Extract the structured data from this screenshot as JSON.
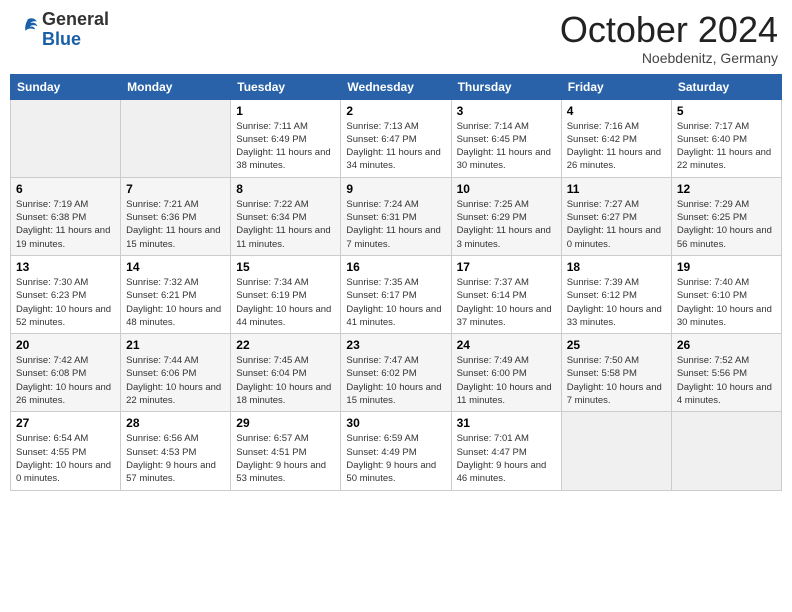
{
  "header": {
    "logo_general": "General",
    "logo_blue": "Blue",
    "month_title": "October 2024",
    "location": "Noebdenitz, Germany"
  },
  "weekdays": [
    "Sunday",
    "Monday",
    "Tuesday",
    "Wednesday",
    "Thursday",
    "Friday",
    "Saturday"
  ],
  "weeks": [
    [
      {
        "day": "",
        "empty": true
      },
      {
        "day": "",
        "empty": true
      },
      {
        "day": "1",
        "line1": "Sunrise: 7:11 AM",
        "line2": "Sunset: 6:49 PM",
        "line3": "Daylight: 11 hours and 38 minutes."
      },
      {
        "day": "2",
        "line1": "Sunrise: 7:13 AM",
        "line2": "Sunset: 6:47 PM",
        "line3": "Daylight: 11 hours and 34 minutes."
      },
      {
        "day": "3",
        "line1": "Sunrise: 7:14 AM",
        "line2": "Sunset: 6:45 PM",
        "line3": "Daylight: 11 hours and 30 minutes."
      },
      {
        "day": "4",
        "line1": "Sunrise: 7:16 AM",
        "line2": "Sunset: 6:42 PM",
        "line3": "Daylight: 11 hours and 26 minutes."
      },
      {
        "day": "5",
        "line1": "Sunrise: 7:17 AM",
        "line2": "Sunset: 6:40 PM",
        "line3": "Daylight: 11 hours and 22 minutes."
      }
    ],
    [
      {
        "day": "6",
        "line1": "Sunrise: 7:19 AM",
        "line2": "Sunset: 6:38 PM",
        "line3": "Daylight: 11 hours and 19 minutes."
      },
      {
        "day": "7",
        "line1": "Sunrise: 7:21 AM",
        "line2": "Sunset: 6:36 PM",
        "line3": "Daylight: 11 hours and 15 minutes."
      },
      {
        "day": "8",
        "line1": "Sunrise: 7:22 AM",
        "line2": "Sunset: 6:34 PM",
        "line3": "Daylight: 11 hours and 11 minutes."
      },
      {
        "day": "9",
        "line1": "Sunrise: 7:24 AM",
        "line2": "Sunset: 6:31 PM",
        "line3": "Daylight: 11 hours and 7 minutes."
      },
      {
        "day": "10",
        "line1": "Sunrise: 7:25 AM",
        "line2": "Sunset: 6:29 PM",
        "line3": "Daylight: 11 hours and 3 minutes."
      },
      {
        "day": "11",
        "line1": "Sunrise: 7:27 AM",
        "line2": "Sunset: 6:27 PM",
        "line3": "Daylight: 11 hours and 0 minutes."
      },
      {
        "day": "12",
        "line1": "Sunrise: 7:29 AM",
        "line2": "Sunset: 6:25 PM",
        "line3": "Daylight: 10 hours and 56 minutes."
      }
    ],
    [
      {
        "day": "13",
        "line1": "Sunrise: 7:30 AM",
        "line2": "Sunset: 6:23 PM",
        "line3": "Daylight: 10 hours and 52 minutes."
      },
      {
        "day": "14",
        "line1": "Sunrise: 7:32 AM",
        "line2": "Sunset: 6:21 PM",
        "line3": "Daylight: 10 hours and 48 minutes."
      },
      {
        "day": "15",
        "line1": "Sunrise: 7:34 AM",
        "line2": "Sunset: 6:19 PM",
        "line3": "Daylight: 10 hours and 44 minutes."
      },
      {
        "day": "16",
        "line1": "Sunrise: 7:35 AM",
        "line2": "Sunset: 6:17 PM",
        "line3": "Daylight: 10 hours and 41 minutes."
      },
      {
        "day": "17",
        "line1": "Sunrise: 7:37 AM",
        "line2": "Sunset: 6:14 PM",
        "line3": "Daylight: 10 hours and 37 minutes."
      },
      {
        "day": "18",
        "line1": "Sunrise: 7:39 AM",
        "line2": "Sunset: 6:12 PM",
        "line3": "Daylight: 10 hours and 33 minutes."
      },
      {
        "day": "19",
        "line1": "Sunrise: 7:40 AM",
        "line2": "Sunset: 6:10 PM",
        "line3": "Daylight: 10 hours and 30 minutes."
      }
    ],
    [
      {
        "day": "20",
        "line1": "Sunrise: 7:42 AM",
        "line2": "Sunset: 6:08 PM",
        "line3": "Daylight: 10 hours and 26 minutes."
      },
      {
        "day": "21",
        "line1": "Sunrise: 7:44 AM",
        "line2": "Sunset: 6:06 PM",
        "line3": "Daylight: 10 hours and 22 minutes."
      },
      {
        "day": "22",
        "line1": "Sunrise: 7:45 AM",
        "line2": "Sunset: 6:04 PM",
        "line3": "Daylight: 10 hours and 18 minutes."
      },
      {
        "day": "23",
        "line1": "Sunrise: 7:47 AM",
        "line2": "Sunset: 6:02 PM",
        "line3": "Daylight: 10 hours and 15 minutes."
      },
      {
        "day": "24",
        "line1": "Sunrise: 7:49 AM",
        "line2": "Sunset: 6:00 PM",
        "line3": "Daylight: 10 hours and 11 minutes."
      },
      {
        "day": "25",
        "line1": "Sunrise: 7:50 AM",
        "line2": "Sunset: 5:58 PM",
        "line3": "Daylight: 10 hours and 7 minutes."
      },
      {
        "day": "26",
        "line1": "Sunrise: 7:52 AM",
        "line2": "Sunset: 5:56 PM",
        "line3": "Daylight: 10 hours and 4 minutes."
      }
    ],
    [
      {
        "day": "27",
        "line1": "Sunrise: 6:54 AM",
        "line2": "Sunset: 4:55 PM",
        "line3": "Daylight: 10 hours and 0 minutes."
      },
      {
        "day": "28",
        "line1": "Sunrise: 6:56 AM",
        "line2": "Sunset: 4:53 PM",
        "line3": "Daylight: 9 hours and 57 minutes."
      },
      {
        "day": "29",
        "line1": "Sunrise: 6:57 AM",
        "line2": "Sunset: 4:51 PM",
        "line3": "Daylight: 9 hours and 53 minutes."
      },
      {
        "day": "30",
        "line1": "Sunrise: 6:59 AM",
        "line2": "Sunset: 4:49 PM",
        "line3": "Daylight: 9 hours and 50 minutes."
      },
      {
        "day": "31",
        "line1": "Sunrise: 7:01 AM",
        "line2": "Sunset: 4:47 PM",
        "line3": "Daylight: 9 hours and 46 minutes."
      },
      {
        "day": "",
        "empty": true
      },
      {
        "day": "",
        "empty": true
      }
    ]
  ]
}
